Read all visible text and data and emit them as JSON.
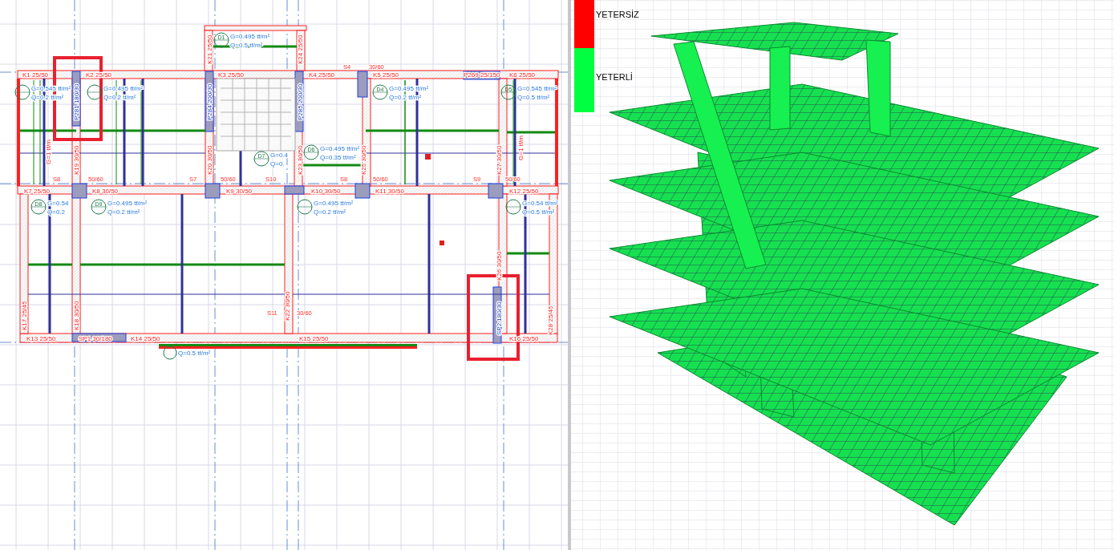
{
  "plan": {
    "beams": [
      {
        "label": "K1 25/50"
      },
      {
        "label": "K2 25/50"
      },
      {
        "label": "K3 25/50"
      },
      {
        "label": "K4 25/50"
      },
      {
        "label": "K5 25/50"
      },
      {
        "label": "P269 25/150"
      },
      {
        "label": "K6 25/50"
      },
      {
        "label": "K7 25/50"
      },
      {
        "label": "K8 30/50"
      },
      {
        "label": "K9 30/50"
      },
      {
        "label": "K10 30/50"
      },
      {
        "label": "K11 30/50"
      },
      {
        "label": "K12 25/50"
      },
      {
        "label": "K13 25/50"
      },
      {
        "label": "SP1 30/180"
      },
      {
        "label": "K14 25/50"
      },
      {
        "label": "K15 25/50"
      },
      {
        "label": "K16 25/50"
      }
    ],
    "vertical_beams": [
      {
        "label": "K21 25/50"
      },
      {
        "label": "K24 25/50"
      },
      {
        "label": "P281 180/30"
      },
      {
        "label": "P284 200/30"
      },
      {
        "label": "P285 200/30"
      },
      {
        "label": "K19 30/50"
      },
      {
        "label": "K20 30/50"
      },
      {
        "label": "K23 30/50"
      },
      {
        "label": "K25 30/50"
      },
      {
        "label": "K27 30/50"
      },
      {
        "label": "K17 25/45"
      },
      {
        "label": "K18 30/50"
      },
      {
        "label": "K22 30/50"
      },
      {
        "label": "K26 30/50"
      },
      {
        "label": "SP2 180/30"
      },
      {
        "label": "K28 25/45"
      }
    ],
    "slabs": [
      {
        "id": "D1",
        "g": "G=0.495 tf/m²",
        "q": "Q=0.5 tf/m²"
      },
      {
        "g": "G=0.545 tf/m²",
        "q": "Q=0.2 tf/m²"
      },
      {
        "g": "G=0.495 tf/m²",
        "q": "Q=0.2 tf/m²"
      },
      {
        "id": "D4",
        "g": "G=0.495 tf/m²",
        "q": "Q=0.2 tf/m²"
      },
      {
        "id": "D5",
        "g": "G=0.545 tf/m²",
        "q": "Q=0.5 tf/m²"
      },
      {
        "id": "D7",
        "g": "G=0.4",
        "q": "Q=0."
      },
      {
        "id": "D6",
        "g": "G=0.495 tf/m²",
        "q": "Q=0.35 tf/m²"
      },
      {
        "id": "D8",
        "g": "G=0.54",
        "q": "Q=0.2"
      },
      {
        "id": "D9",
        "g": "G=0.495 tf/m²",
        "q": "Q=0.2 tf/m²"
      },
      {
        "g": "G=0.495 tf/m²",
        "q": "Q=0.2 tf/m²"
      },
      {
        "g": "G=0.54 tf/m²",
        "q": "Q=0.5 tf/m²"
      }
    ],
    "balcony_load": "Q=0.5 tf/m²",
    "line_loads": [
      "G=1 tf/m",
      "G=1 tf/m"
    ],
    "notes": [
      "S4",
      "30/60",
      "S8",
      "50/60",
      "S7",
      "50/60",
      "S10",
      "S8",
      "50/60",
      "S9",
      "50/60",
      "S11",
      "30/60"
    ]
  },
  "model_view": {
    "legend": [
      {
        "label": "YETERSİZ",
        "color": "#ff0000"
      },
      {
        "label": "YETERLİ",
        "color": "#00ff40"
      }
    ]
  }
}
